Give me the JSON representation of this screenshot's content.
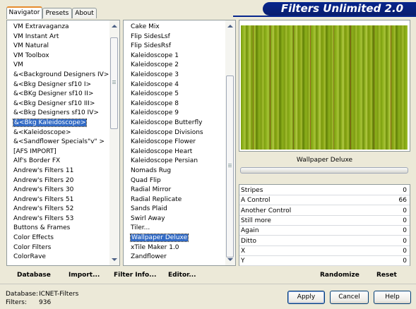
{
  "tabs": [
    "Navigator",
    "Presets",
    "About"
  ],
  "banner_title": "Filters Unlimited 2.0",
  "categories": [
    "VM Extravaganza",
    "VM Instant Art",
    "VM Natural",
    "VM Toolbox",
    "VM",
    "&<Background Designers IV>",
    "&<Bkg Designer sf10 I>",
    "&<BKg Designer sf10 II>",
    "&<Bkg Designer sf10 III>",
    "&<Bkg Designers sf10 IV>",
    "&<Bkg Kaleidoscope>",
    "&<Kaleidoscope>",
    "&<Sandflower Specials\"v\" >",
    "[AFS IMPORT]",
    "Alf's Border FX",
    "Andrew's Filters 11",
    "Andrew's Filters 20",
    "Andrew's Filters 30",
    "Andrew's Filters 51",
    "Andrew's Filters 52",
    "Andrew's Filters 53",
    "Buttons & Frames",
    "Color Effects",
    "Color Filters",
    "ColorRave"
  ],
  "filters": [
    "Cake Mix",
    "Flip SidesLsf",
    "Flip SidesRsf",
    "Kaleidoscope 1",
    "Kaleidoscope 2",
    "Kaleidoscope 3",
    "Kaleidoscope 4",
    "Kaleidoscope 5",
    "Kaleidoscope 8",
    "Kaleidoscope 9",
    "Kaleidoscope Butterfly",
    "Kaleidoscope Divisions",
    "Kaleidoscope Flower",
    "Kaleidoscope Heart",
    "Kaleidoscope Persian",
    "Nomads Rug",
    "Quad Flip",
    "Radial Mirror",
    "Radial Replicate",
    "Sands Plaid",
    "Swirl Away",
    "Tiler...",
    "Wallpaper Deluxe",
    "xTile Maker 1.0",
    "Zandflower"
  ],
  "selected_filter_index": 22,
  "selected_category_index": 10,
  "preview": {
    "filter_name": "Wallpaper Deluxe"
  },
  "controls": [
    {
      "label": "Stripes",
      "value": "0"
    },
    {
      "label": "A Control",
      "value": "66"
    },
    {
      "label": "Another Control",
      "value": "0"
    },
    {
      "label": "Still more",
      "value": "0"
    },
    {
      "label": "Again",
      "value": "0"
    },
    {
      "label": "Ditto",
      "value": "0"
    },
    {
      "label": "X",
      "value": "0"
    },
    {
      "label": "Y",
      "value": "0"
    }
  ],
  "links": {
    "database": "Database",
    "import": "Import...",
    "filter_info": "Filter Info...",
    "editor": "Editor...",
    "randomize": "Randomize",
    "reset": "Reset"
  },
  "footer": {
    "database_label": "Database:",
    "database_value": "ICNET-Filters",
    "filters_label": "Filters:",
    "filters_value": "936"
  },
  "buttons": {
    "apply": "Apply",
    "cancel": "Cancel",
    "help": "Help"
  },
  "colors": {
    "banner": "#06258d",
    "selection": "#316ac5",
    "tab_highlight": "#e68b2c"
  }
}
